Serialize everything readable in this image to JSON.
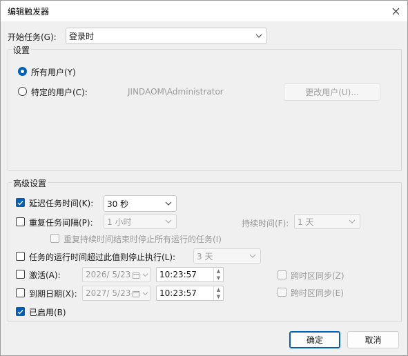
{
  "window": {
    "title": "编辑触发器"
  },
  "start_task": {
    "label": "开始任务(G):",
    "value": "登录时"
  },
  "settings": {
    "legend": "设置",
    "all_users": "所有用户(Y)",
    "specific_user": "特定的用户(C):",
    "user_name": "JINDAOM\\Administrator",
    "change_user": "更改用户(U)..."
  },
  "advanced": {
    "legend": "高级设置",
    "delay": {
      "label": "延迟任务时间(K):",
      "value": "30 秒"
    },
    "repeat": {
      "label": "重复任务间隔(P):",
      "value": "1 小时",
      "duration_label": "持续时间(F):",
      "duration_value": "1 天"
    },
    "stop_all": "重复持续时间结束时停止所有运行的任务(I)",
    "stop_long": {
      "label": "任务的运行时间超过此值则停止执行(L):",
      "value": "3 天"
    },
    "activate": {
      "label": "激活(A):",
      "date": "2026/  5/23",
      "time": "10:23:57",
      "sync": "跨时区同步(Z)"
    },
    "expire": {
      "label": "到期日期(X):",
      "date": "2027/  5/23",
      "time": "10:23:57",
      "sync": "跨时区同步(E)"
    },
    "enabled": "已启用(B)"
  },
  "buttons": {
    "ok": "确定",
    "cancel": "取消"
  },
  "colors": {
    "accent": "#005fb8"
  }
}
